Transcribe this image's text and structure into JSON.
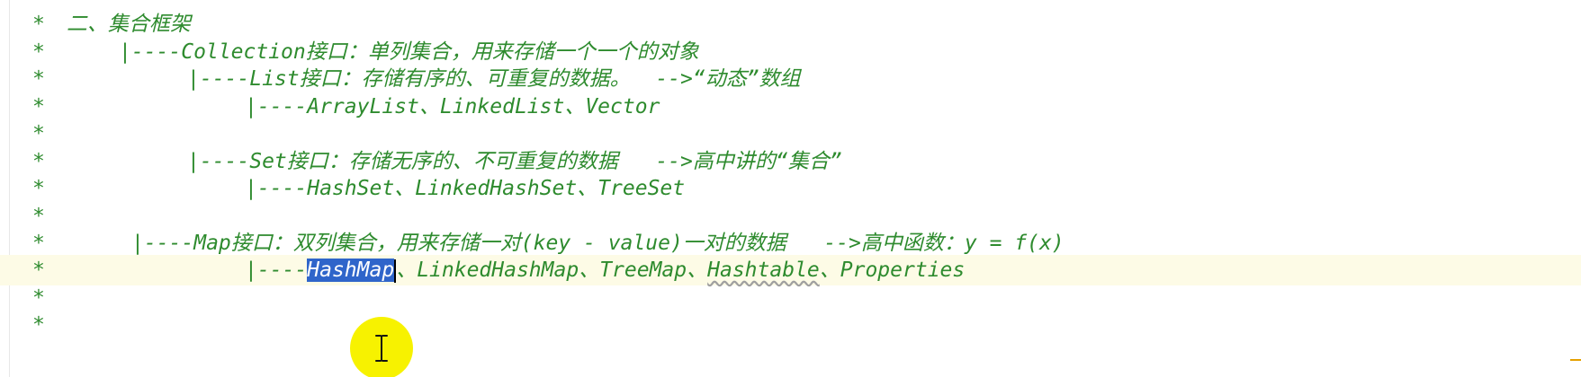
{
  "editor": {
    "lines": [
      {
        "star": "*",
        "text": " 二、集合框架"
      },
      {
        "star": "*",
        "text": "|----Collection接口：单列集合，用来存储一个一个的对象"
      },
      {
        "star": "*",
        "text": "|----List接口：存储有序的、可重复的数据。  -->“动态”数组"
      },
      {
        "star": "*",
        "text": "|----ArrayList、LinkedList、Vector"
      },
      {
        "star": "*",
        "text": ""
      },
      {
        "star": "*",
        "text": "|----Set接口：存储无序的、不可重复的数据   -->高中讲的“集合”"
      },
      {
        "star": "*",
        "text": "|----HashSet、LinkedHashSet、TreeSet"
      },
      {
        "star": "*",
        "text": ""
      },
      {
        "star": "*",
        "text": "|----Map接口：双列集合，用来存储一对(key - value)一对的数据   -->高中函数：y = f(x)"
      },
      {
        "star": "*",
        "prefix": "|----",
        "selected": "HashMap",
        "sep1": "、LinkedHashMap、TreeMap、",
        "squiggled": "Hashtable",
        "suffix": "、Properties"
      },
      {
        "star": "*",
        "text": ""
      },
      {
        "star": "*",
        "text": ""
      }
    ],
    "colors": {
      "comment": "#2e8b2e",
      "selection": "#2f65ca",
      "current_line": "#fdfbe6",
      "cursor_highlight": "#f7f200"
    },
    "icons": {
      "intention": "lightbulb-icon",
      "pointer": "ibeam-cursor-icon"
    }
  }
}
